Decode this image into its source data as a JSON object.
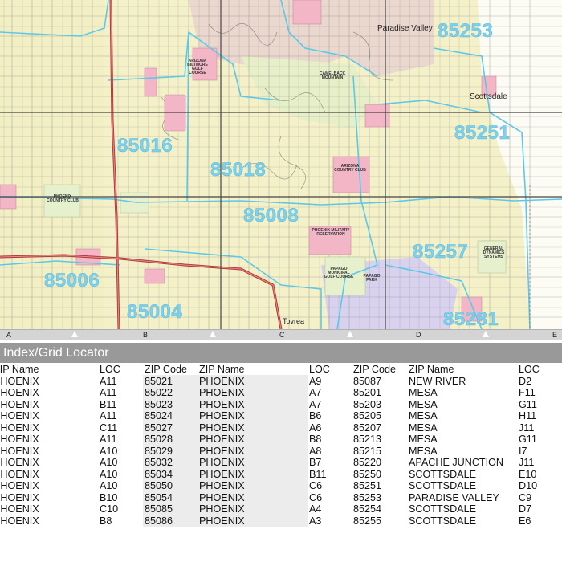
{
  "map": {
    "zip_labels": [
      "85016",
      "85018",
      "85008",
      "85006",
      "85004",
      "85251",
      "85253",
      "85257",
      "85281"
    ],
    "place_labels": [
      "Paradise Valley",
      "Scottsdale",
      "Tovrea"
    ],
    "poi_labels": [
      "ARIZONA BILTMORE GOLF COURSE",
      "CAMELBACK MOUNTAIN",
      "ARIZONA COUNTRY CLUB",
      "PHOENIX COUNTRY CLUB",
      "PHOENIX MILITARY RESERVATION",
      "PAPAGO MUNICIPAL GOLF COURSE",
      "PAPAGO PARK",
      "GENERAL DYNAMICS SYSTEMS"
    ],
    "colors": {
      "residential": "#f4f1c9",
      "zip_boundary": "#5cc8e8",
      "parks": "#e9f2cf",
      "landmarks": "#f3b6c6",
      "reservation": "#d9d2ef",
      "highway": "#b23a3a"
    }
  },
  "ruler": {
    "letters": [
      "A",
      "B",
      "C",
      "D",
      "E"
    ]
  },
  "index": {
    "title": "Index/Grid Locator",
    "headers": [
      "ZIP Name",
      "LOC",
      "ZIP Code",
      "ZIP Name",
      "LOC",
      "ZIP Code",
      "ZIP Name",
      "LOC"
    ],
    "col1_name": [
      "PHOENIX",
      "PHOENIX",
      "PHOENIX",
      "PHOENIX",
      "PHOENIX",
      "PHOENIX",
      "PHOENIX",
      "PHOENIX",
      "PHOENIX",
      "PHOENIX",
      "PHOENIX",
      "PHOENIX",
      "PHOENIX"
    ],
    "col1_loc": [
      "A11",
      "A11",
      "B11",
      "A11",
      "C11",
      "A11",
      "A10",
      "A10",
      "A10",
      "A10",
      "B10",
      "C10",
      "B8"
    ],
    "col2_code": [
      "85021",
      "85022",
      "85023",
      "85024",
      "85027",
      "85028",
      "85029",
      "85032",
      "85034",
      "85050",
      "85054",
      "85085",
      "85086"
    ],
    "col2_name": [
      "PHOENIX",
      "PHOENIX",
      "PHOENIX",
      "PHOENIX",
      "PHOENIX",
      "PHOENIX",
      "PHOENIX",
      "PHOENIX",
      "PHOENIX",
      "PHOENIX",
      "PHOENIX",
      "PHOENIX",
      "PHOENIX"
    ],
    "col2_loc": [
      "A9",
      "A7",
      "A7",
      "B6",
      "A6",
      "B8",
      "A8",
      "B7",
      "B11",
      "C6",
      "C6",
      "A4",
      "A3"
    ],
    "col3_code": [
      "85087",
      "85201",
      "85203",
      "85205",
      "85207",
      "85213",
      "85215",
      "85220",
      "85250",
      "85251",
      "85253",
      "85254",
      "85255"
    ],
    "col3_name": [
      "NEW RIVER",
      "MESA",
      "MESA",
      "MESA",
      "MESA",
      "MESA",
      "MESA",
      "APACHE JUNCTION",
      "SCOTTSDALE",
      "SCOTTSDALE",
      "PARADISE VALLEY",
      "SCOTTSDALE",
      "SCOTTSDALE"
    ],
    "col3_loc": [
      "D2",
      "F11",
      "G11",
      "H11",
      "J11",
      "G11",
      "I7",
      "J11",
      "E10",
      "D10",
      "C9",
      "D7",
      "E6"
    ]
  }
}
